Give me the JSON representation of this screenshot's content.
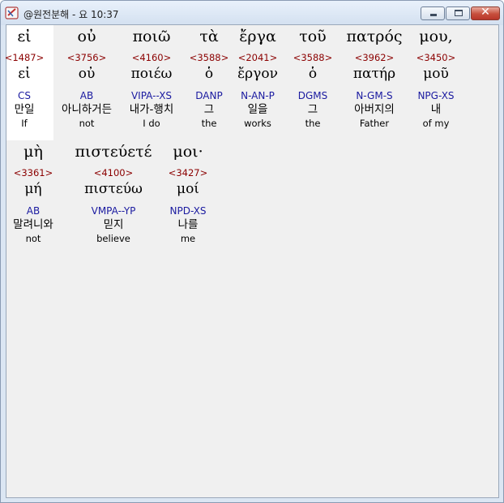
{
  "window": {
    "title": "@원전분해 - 요 10:37",
    "close_glyph": "✕"
  },
  "rows": [
    {
      "words": [
        {
          "greek": "εἰ",
          "strong": "<1487>",
          "lemma": "εἰ",
          "morph": "CS",
          "korean": "만일",
          "english": "If",
          "highlighted": true
        },
        {
          "greek": "οὐ",
          "strong": "<3756>",
          "lemma": "οὐ",
          "morph": "AB",
          "korean": "아니하거든",
          "english": "not"
        },
        {
          "greek": "ποιῶ",
          "strong": "<4160>",
          "lemma": "ποιέω",
          "morph": "VIPA--XS",
          "korean": "내가-행치",
          "english": "I do"
        },
        {
          "greek": "τὰ",
          "strong": "<3588>",
          "lemma": "ὁ",
          "morph": "DANP",
          "korean": "그",
          "english": "the"
        },
        {
          "greek": "ἔργα",
          "strong": "<2041>",
          "lemma": "ἔργον",
          "morph": "N-AN-P",
          "korean": "일을",
          "english": "works"
        },
        {
          "greek": "τοῦ",
          "strong": "<3588>",
          "lemma": "ὁ",
          "morph": "DGMS",
          "korean": "그",
          "english": "the"
        },
        {
          "greek": "πατρός",
          "strong": "<3962>",
          "lemma": "πατήρ",
          "morph": "N-GM-S",
          "korean": "아버지의",
          "english": "Father"
        },
        {
          "greek": "μου,",
          "strong": "<3450>",
          "lemma": "μοῦ",
          "morph": "NPG-XS",
          "korean": "내",
          "english": "of my"
        }
      ]
    },
    {
      "words": [
        {
          "greek": "μὴ",
          "strong": "<3361>",
          "lemma": "μή",
          "morph": "AB",
          "korean": "말려니와",
          "english": "not"
        },
        {
          "greek": "πιστεύετέ",
          "strong": "<4100>",
          "lemma": "πιστεύω",
          "morph": "VMPA--YP",
          "korean": "믿지",
          "english": "believe"
        },
        {
          "greek": "μοι·",
          "strong": "<3427>",
          "lemma": "μοί",
          "morph": "NPD-XS",
          "korean": "나를",
          "english": "me"
        }
      ]
    }
  ]
}
